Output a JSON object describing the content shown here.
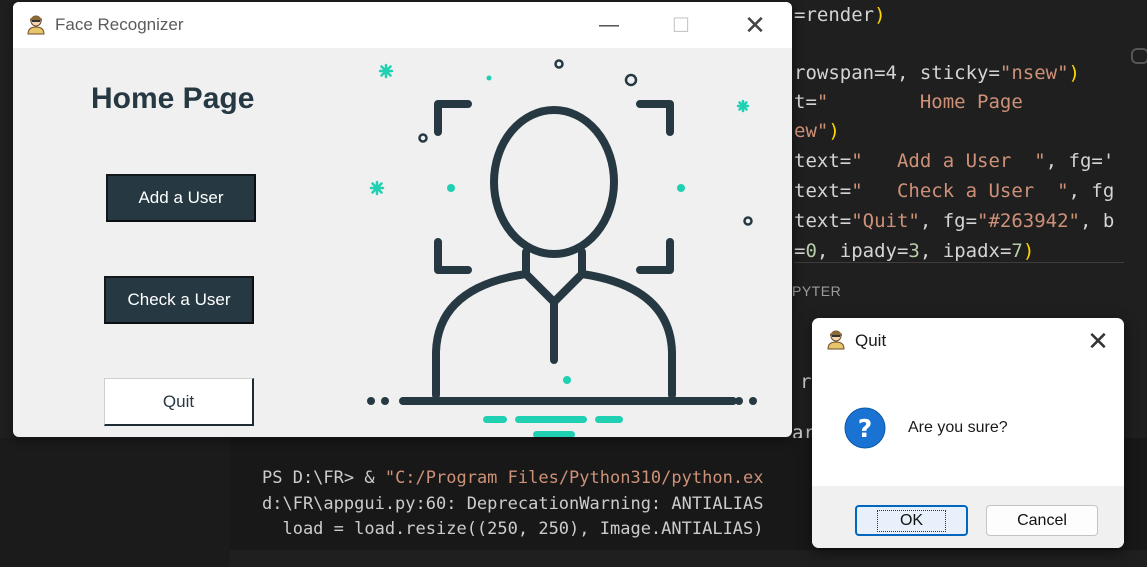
{
  "editor": {
    "code_lines": [
      {
        "parts": [
          {
            "c": "w",
            "t": "=render"
          },
          {
            "c": "p",
            "t": ")"
          }
        ]
      },
      {
        "parts": [
          {
            "c": "w",
            "t": "rowspan=4, sticky="
          },
          {
            "c": "s",
            "t": "\"nsew\""
          },
          {
            "c": "p",
            "t": ")"
          }
        ]
      },
      {
        "parts": [
          {
            "c": "w",
            "t": "t="
          },
          {
            "c": "s",
            "t": "\"        Home Page"
          }
        ]
      },
      {
        "parts": [
          {
            "c": "s",
            "t": "ew\""
          },
          {
            "c": "p",
            "t": ")"
          }
        ]
      },
      {
        "parts": [
          {
            "c": "w",
            "t": "text="
          },
          {
            "c": "s",
            "t": "\"   Add a User  \""
          },
          {
            "c": "w",
            "t": ", fg='"
          }
        ]
      },
      {
        "parts": [
          {
            "c": "w",
            "t": "text="
          },
          {
            "c": "s",
            "t": "\"   Check a User  \""
          },
          {
            "c": "w",
            "t": ", fg"
          }
        ]
      },
      {
        "parts": [
          {
            "c": "w",
            "t": "text="
          },
          {
            "c": "s",
            "t": "\"Quit\""
          },
          {
            "c": "w",
            "t": ", fg="
          },
          {
            "c": "s",
            "t": "\"#263942\""
          },
          {
            "c": "w",
            "t": ", b"
          }
        ]
      },
      {
        "parts": [
          {
            "c": "w",
            "t": "="
          },
          {
            "c": "n",
            "t": "0"
          },
          {
            "c": "w",
            "t": ", ipady="
          },
          {
            "c": "n",
            "t": "3"
          },
          {
            "c": "w",
            "t": ", ipadx="
          },
          {
            "c": "n",
            "t": "7"
          },
          {
            "c": "p",
            "t": ")"
          }
        ]
      }
    ],
    "panel_label": "PYTER",
    "partial_r": "r",
    "partial_ar": "ar",
    "terminal": {
      "line1_prompt": "PS D:\\FR> & ",
      "line1_path": "\"C:/Program Files/Python310/python.ex",
      "line2": "d:\\FR\\appgui.py:60: DeprecationWarning: ANTIALIAS",
      "line3": "  load = load.resize((250, 250), Image.ANTIALIAS)"
    }
  },
  "main_window": {
    "title": "Face Recognizer",
    "minimize_glyph": "—",
    "maximize_glyph": "☐",
    "close_glyph": "✕",
    "heading": "Home Page",
    "buttons": {
      "add_user": "Add a User",
      "check_user": "Check a User",
      "quit": "Quit"
    },
    "illustration_icon": "face-scan-person-icon"
  },
  "dialog": {
    "title": "Quit",
    "close_glyph": "✕",
    "icon": "question-icon",
    "message": "Are you sure?",
    "ok_label": "OK",
    "cancel_label": "Cancel"
  },
  "colors": {
    "button_dark": "#263942",
    "accent_teal": "#1fd1b2",
    "dialog_accent": "#0067c0"
  }
}
